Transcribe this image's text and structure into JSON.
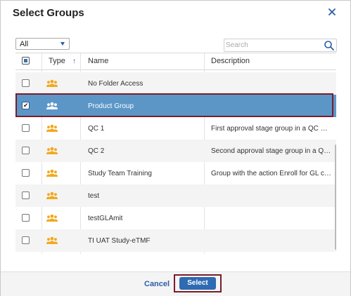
{
  "dialog": {
    "title": "Select Groups"
  },
  "filter": {
    "selected": "All"
  },
  "search": {
    "placeholder": "Search"
  },
  "table": {
    "columns": {
      "type": "Type",
      "name": "Name",
      "description": "Description"
    },
    "sort_indicator": "↑",
    "rows": [
      {
        "name": "No Folder Access",
        "description": "",
        "checked": false,
        "selected": false
      },
      {
        "name": "Product Group",
        "description": "",
        "checked": true,
        "selected": true
      },
      {
        "name": "QC 1",
        "description": "First approval stage group in a QC wor...",
        "checked": false,
        "selected": false
      },
      {
        "name": "QC 2",
        "description": "Second approval stage group in a QC w...",
        "checked": false,
        "selected": false
      },
      {
        "name": "Study Team Training",
        "description": "Group with the action Enroll for GL cou...",
        "checked": false,
        "selected": false
      },
      {
        "name": "test",
        "description": "",
        "checked": false,
        "selected": false
      },
      {
        "name": "testGLAmit",
        "description": "",
        "checked": false,
        "selected": false
      },
      {
        "name": "TI UAT Study-eTMF",
        "description": "",
        "checked": false,
        "selected": false
      }
    ]
  },
  "footer": {
    "cancel_label": "Cancel",
    "select_label": "Select"
  },
  "icons": {
    "close": "close-icon",
    "search": "search-icon",
    "group": "group-icon",
    "check": "checkmark-icon"
  },
  "colors": {
    "accent": "#2f6bb3",
    "selected_row": "#5b96c7",
    "highlight_outline": "#7a1c2a",
    "group_icon": "#f2a81d"
  }
}
